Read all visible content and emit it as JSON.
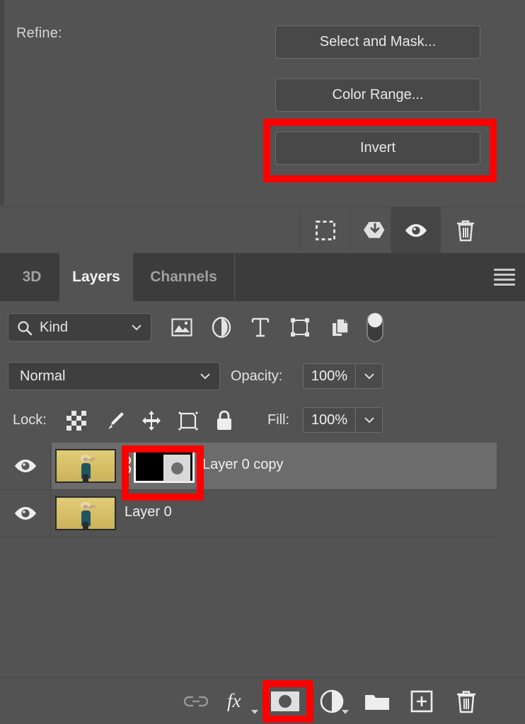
{
  "colors": {
    "panel_bg": "#535353",
    "panel_dark": "#3c3c3c",
    "button_bg": "#484848",
    "highlight_red": "#FE0000",
    "selected_row": "#6C6C6C",
    "text": "#E8E8E8"
  },
  "refine": {
    "label": "Refine:",
    "buttons": [
      {
        "label": "Select and Mask...",
        "name": "select-and-mask-button"
      },
      {
        "label": "Color Range...",
        "name": "color-range-button"
      },
      {
        "label": "Invert",
        "name": "invert-button",
        "highlighted": true
      }
    ]
  },
  "mask_toolbar": {
    "icons": [
      {
        "name": "load-selection-from-mask-icon",
        "glyph": "marching-ants-selection"
      },
      {
        "name": "apply-mask-icon",
        "glyph": "diamond-arrow"
      },
      {
        "name": "disable-enable-mask-icon",
        "glyph": "eye",
        "active": true
      },
      {
        "name": "delete-mask-icon",
        "glyph": "trash"
      }
    ]
  },
  "tabs": {
    "items": [
      {
        "label": "3D",
        "name": "tab-3d",
        "active": false
      },
      {
        "label": "Layers",
        "name": "tab-layers",
        "active": true
      },
      {
        "label": "Channels",
        "name": "tab-channels",
        "active": false
      }
    ],
    "menu_icon": "hamburger-menu-icon"
  },
  "filter_row": {
    "kind_label": "Kind",
    "search_icon": "search-icon",
    "caret_icon": "chevron-down-icon",
    "type_filters": [
      {
        "name": "filter-pixel-layers-icon",
        "glyph": "image"
      },
      {
        "name": "filter-adjustment-layers-icon",
        "glyph": "half-circle"
      },
      {
        "name": "filter-type-layers-icon",
        "glyph": "letter-t"
      },
      {
        "name": "filter-shape-layers-icon",
        "glyph": "shape-frame"
      },
      {
        "name": "filter-smart-objects-icon",
        "glyph": "smart-object"
      }
    ],
    "toggle": {
      "name": "filter-enable-toggle",
      "state": "on"
    }
  },
  "blend_row": {
    "blend_mode": "Normal",
    "opacity_label": "Opacity:",
    "opacity_value": "100%",
    "caret_icon": "chevron-down-icon"
  },
  "lock_row": {
    "lock_label": "Lock:",
    "lock_icons": [
      {
        "name": "lock-transparent-pixels-icon",
        "glyph": "checkerboard"
      },
      {
        "name": "lock-image-pixels-icon",
        "glyph": "paintbrush"
      },
      {
        "name": "lock-position-icon",
        "glyph": "move-arrows"
      },
      {
        "name": "lock-artboard-nesting-icon",
        "glyph": "artboard"
      },
      {
        "name": "lock-all-icon",
        "glyph": "padlock"
      }
    ],
    "fill_label": "Fill:",
    "fill_value": "100%"
  },
  "layers": [
    {
      "name": "Layer 0 copy",
      "visible": true,
      "selected": true,
      "has_link": true,
      "has_mask": true,
      "mask_highlighted": true,
      "thumbnail": "photo-woman-yellow-wall"
    },
    {
      "name": "Layer 0",
      "visible": true,
      "selected": false,
      "has_link": false,
      "has_mask": false,
      "mask_highlighted": false,
      "thumbnail": "photo-woman-yellow-wall"
    }
  ],
  "bottom_toolbar": {
    "buttons": [
      {
        "name": "link-layers-button",
        "glyph": "link",
        "dimmed": true,
        "highlighted": false
      },
      {
        "name": "layer-style-fx-button",
        "glyph": "fx",
        "dimmed": false,
        "highlighted": false,
        "has_caret": true
      },
      {
        "name": "add-layer-mask-button",
        "glyph": "add-mask",
        "dimmed": false,
        "highlighted": true
      },
      {
        "name": "new-adjustment-layer-button",
        "glyph": "half-circle",
        "dimmed": false,
        "highlighted": false,
        "has_caret": true
      },
      {
        "name": "new-group-button",
        "glyph": "folder",
        "dimmed": false,
        "highlighted": false
      },
      {
        "name": "new-layer-button",
        "glyph": "plus-square",
        "dimmed": false,
        "highlighted": false
      },
      {
        "name": "delete-layer-button",
        "glyph": "trash",
        "dimmed": false,
        "highlighted": false
      }
    ]
  }
}
